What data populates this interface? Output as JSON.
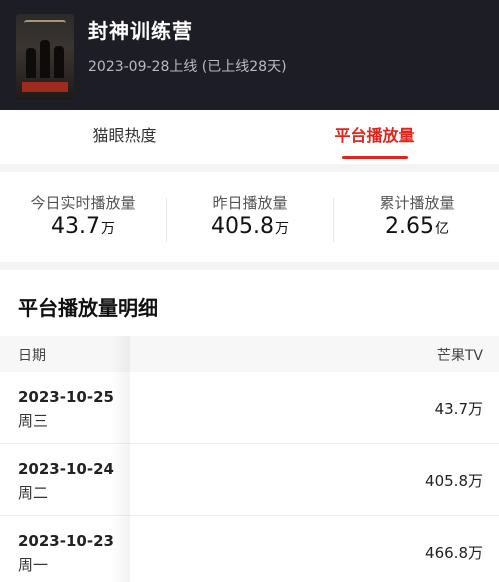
{
  "movie": {
    "title": "封神训练营",
    "release_info": "2023-09-28上线 (已上线28天)"
  },
  "tabs": [
    {
      "label": "猫眼热度",
      "active": false
    },
    {
      "label": "平台播放量",
      "active": true
    }
  ],
  "stats": [
    {
      "label": "今日实时播放量",
      "value": "43.7",
      "unit": "万"
    },
    {
      "label": "昨日播放量",
      "value": "405.8",
      "unit": "万"
    },
    {
      "label": "累计播放量",
      "value": "2.65",
      "unit": "亿"
    }
  ],
  "detail": {
    "title": "平台播放量明细",
    "columns": [
      "日期",
      "芒果TV"
    ],
    "rows": [
      {
        "date": "2023-10-25",
        "weekday": "周三",
        "value": "43.7万"
      },
      {
        "date": "2023-10-24",
        "weekday": "周二",
        "value": "405.8万"
      },
      {
        "date": "2023-10-23",
        "weekday": "周一",
        "value": "466.8万"
      }
    ]
  },
  "colors": {
    "header_bg": "#1d1d26",
    "accent": "#e1251b"
  }
}
